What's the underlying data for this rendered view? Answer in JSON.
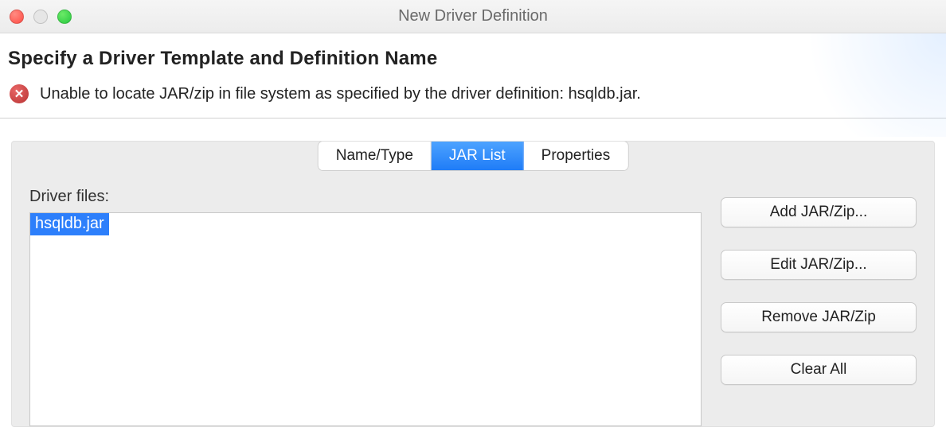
{
  "window": {
    "title": "New Driver Definition"
  },
  "header": {
    "heading": "Specify a Driver Template and Definition Name",
    "error_message": "Unable to locate JAR/zip in file system as specified by the driver definition: hsqldb.jar."
  },
  "tabs": {
    "name_type": "Name/Type",
    "jar_list": "JAR List",
    "properties": "Properties",
    "active": "jar_list"
  },
  "jar_panel": {
    "label": "Driver files:",
    "files": [
      "hsqldb.jar"
    ]
  },
  "buttons": {
    "add": "Add JAR/Zip...",
    "edit": "Edit JAR/Zip...",
    "remove": "Remove JAR/Zip",
    "clear": "Clear All"
  }
}
